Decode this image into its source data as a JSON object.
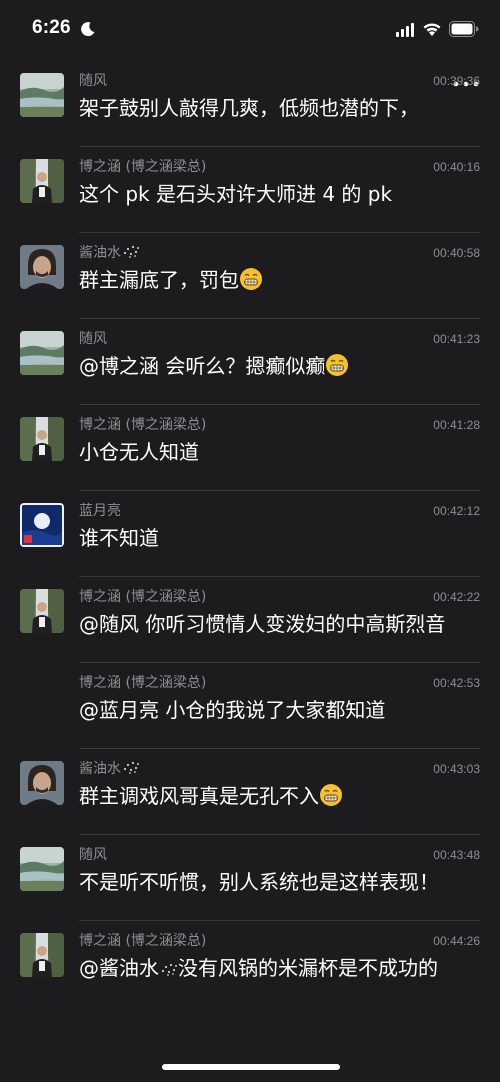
{
  "status_bar": {
    "time": "6:26"
  },
  "messages": [
    {
      "sender": "随风",
      "time": "00:39:36",
      "text": "架子鼓别人敲得几爽，低频也潜的下，",
      "avatar": "river-landscape",
      "emoji": false
    },
    {
      "sender": "博之涵 (博之涵梁总)",
      "time": "00:40:16",
      "text": "这个 pk 是石头对许大师进 4 的 pk",
      "avatar": "man-waterfall",
      "emoji": false
    },
    {
      "sender": "酱油水",
      "time": "00:40:58",
      "text": "群主漏底了，罚包",
      "avatar": "man-portrait",
      "emoji": true
    },
    {
      "sender": "随风",
      "time": "00:41:23",
      "text": "@博之涵 会听么？摁癫似癫",
      "avatar": "river-landscape",
      "emoji": true
    },
    {
      "sender": "博之涵 (博之涵梁总)",
      "time": "00:41:28",
      "text": "小仓无人知道",
      "avatar": "man-waterfall",
      "emoji": false
    },
    {
      "sender": "蓝月亮",
      "time": "00:42:12",
      "text": "谁不知道",
      "avatar": "moon-night",
      "emoji": false
    },
    {
      "sender": "博之涵 (博之涵梁总)",
      "time": "00:42:22",
      "text": "@随风 你听习惯情人变泼妇的中高斯烈音",
      "avatar": "man-waterfall",
      "emoji": false
    },
    {
      "sender": "博之涵 (博之涵梁总)",
      "time": "00:42:53",
      "text": "@蓝月亮 小仓的我说了大家都知道",
      "avatar": "none",
      "emoji": false
    },
    {
      "sender": "酱油水",
      "time": "00:43:03",
      "text": "群主调戏风哥真是无孔不入",
      "avatar": "man-portrait",
      "emoji": true
    },
    {
      "sender": "随风",
      "time": "00:43:48",
      "text": "不是听不听惯，别人系统也是这样表现！",
      "avatar": "river-landscape",
      "emoji": false
    },
    {
      "sender": "博之涵 (博之涵梁总)",
      "time": "00:44:26",
      "text_before": "@酱油水",
      "text_after": "没有风锅的米漏杯是不成功的",
      "avatar": "man-waterfall",
      "emoji": false
    }
  ]
}
